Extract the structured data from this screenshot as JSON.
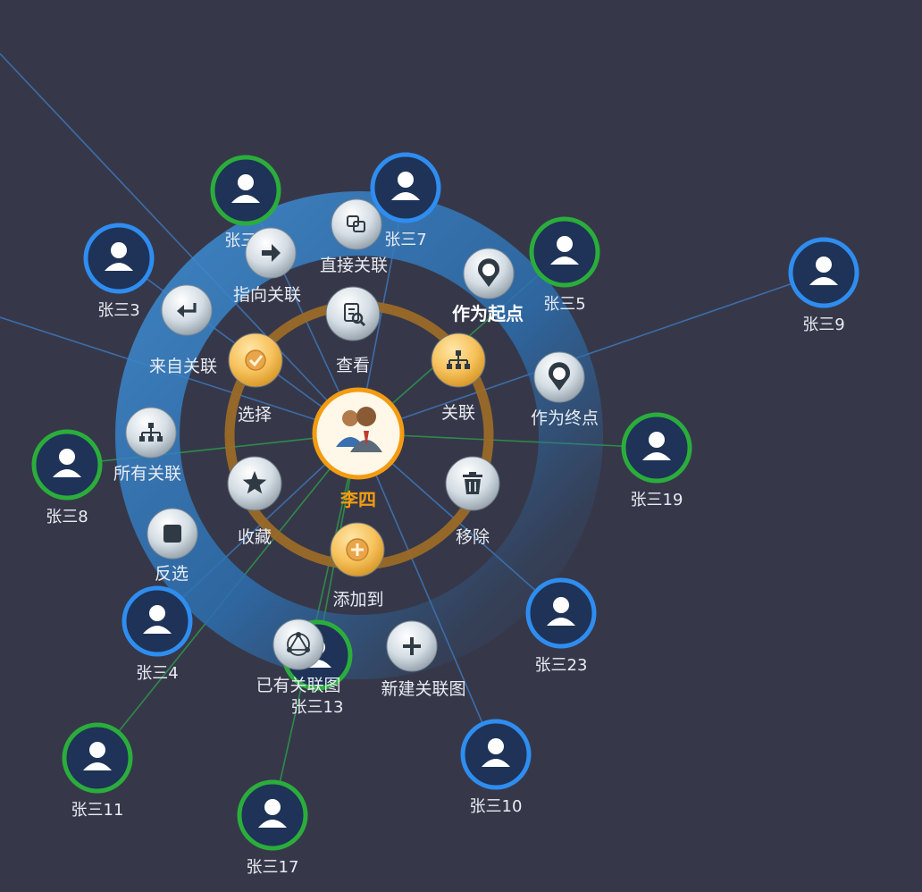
{
  "center": {
    "label": "李四",
    "icon": "group-icon",
    "color": "#f39c12"
  },
  "colors": {
    "background": "#363849",
    "blue_ring": "#2f8df0",
    "green_ring": "#2bad3c",
    "node_fill": "#1e3357",
    "outer_ring": "#2f7fc9",
    "inner_ring": "#9b6a28",
    "label": "#e8ecf2",
    "menu_bold": "#ffffff"
  },
  "nodes": [
    {
      "id": "n3",
      "label": "张三3",
      "ring": "blue"
    },
    {
      "id": "n1",
      "label": "张三1",
      "ring": "green"
    },
    {
      "id": "n7",
      "label": "张三7",
      "ring": "blue"
    },
    {
      "id": "n5",
      "label": "张三5",
      "ring": "green"
    },
    {
      "id": "n9",
      "label": "张三9",
      "ring": "blue"
    },
    {
      "id": "n19",
      "label": "张三19",
      "ring": "green"
    },
    {
      "id": "n8",
      "label": "张三8",
      "ring": "green"
    },
    {
      "id": "n4",
      "label": "张三4",
      "ring": "blue"
    },
    {
      "id": "n23",
      "label": "张三23",
      "ring": "blue"
    },
    {
      "id": "n13",
      "label": "张三13",
      "ring": "green"
    },
    {
      "id": "n11",
      "label": "张三11",
      "ring": "green"
    },
    {
      "id": "n17",
      "label": "张三17",
      "ring": "green"
    },
    {
      "id": "n10",
      "label": "张三10",
      "ring": "blue"
    }
  ],
  "inner_menu": [
    {
      "id": "view",
      "label": "查看",
      "icon": "search-doc-icon",
      "style": "silver"
    },
    {
      "id": "relate",
      "label": "关联",
      "icon": "hierarchy-icon",
      "style": "gold"
    },
    {
      "id": "remove",
      "label": "移除",
      "icon": "trash-icon",
      "style": "silver"
    },
    {
      "id": "add_to",
      "label": "添加到",
      "icon": "plus-circle-icon",
      "style": "gold"
    },
    {
      "id": "favorite",
      "label": "收藏",
      "icon": "star-icon",
      "style": "silver"
    },
    {
      "id": "select",
      "label": "选择",
      "icon": "check-icon",
      "style": "gold"
    }
  ],
  "outer_menu": [
    {
      "id": "direct",
      "label": "直接关联",
      "icon": "copy-icon",
      "bold": false
    },
    {
      "id": "as_start",
      "label": "作为起点",
      "icon": "start-pin-icon",
      "bold": true
    },
    {
      "id": "as_end",
      "label": "作为终点",
      "icon": "end-pin-icon",
      "bold": false
    },
    {
      "id": "new_graph",
      "label": "新建关联图",
      "icon": "plus-icon",
      "bold": false
    },
    {
      "id": "existing",
      "label": "已有关联图",
      "icon": "network-icon",
      "bold": false
    },
    {
      "id": "invert",
      "label": "反选",
      "icon": "square-icon",
      "bold": false
    },
    {
      "id": "all_rel",
      "label": "所有关联",
      "icon": "hierarchy-icon",
      "bold": false
    },
    {
      "id": "from_rel",
      "label": "来自关联",
      "icon": "return-arrow-icon",
      "bold": false
    },
    {
      "id": "to_rel",
      "label": "指向关联",
      "icon": "right-arrow-icon",
      "bold": false
    }
  ]
}
